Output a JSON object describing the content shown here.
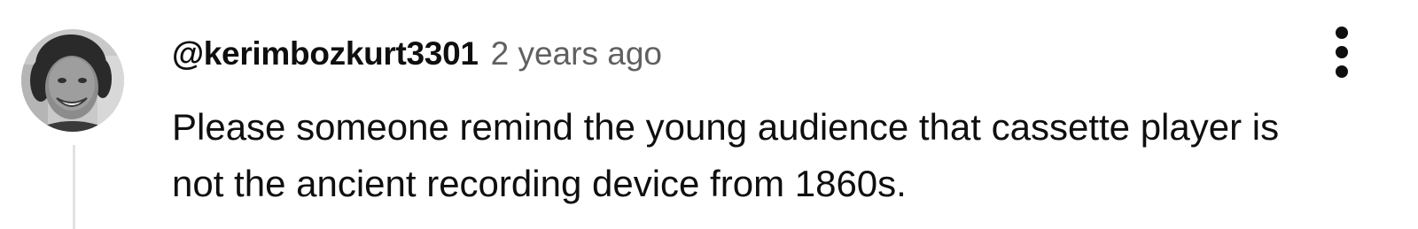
{
  "comment": {
    "username": "@kerimbozkurt3301",
    "timestamp": "2 years ago",
    "text_lines": [
      "Please someone remind the young audience that cassette player is",
      "not the ancient recording device from 1860s."
    ],
    "avatar_icon": "user-avatar-photo",
    "menu_icon": "more-vertical-icon"
  }
}
